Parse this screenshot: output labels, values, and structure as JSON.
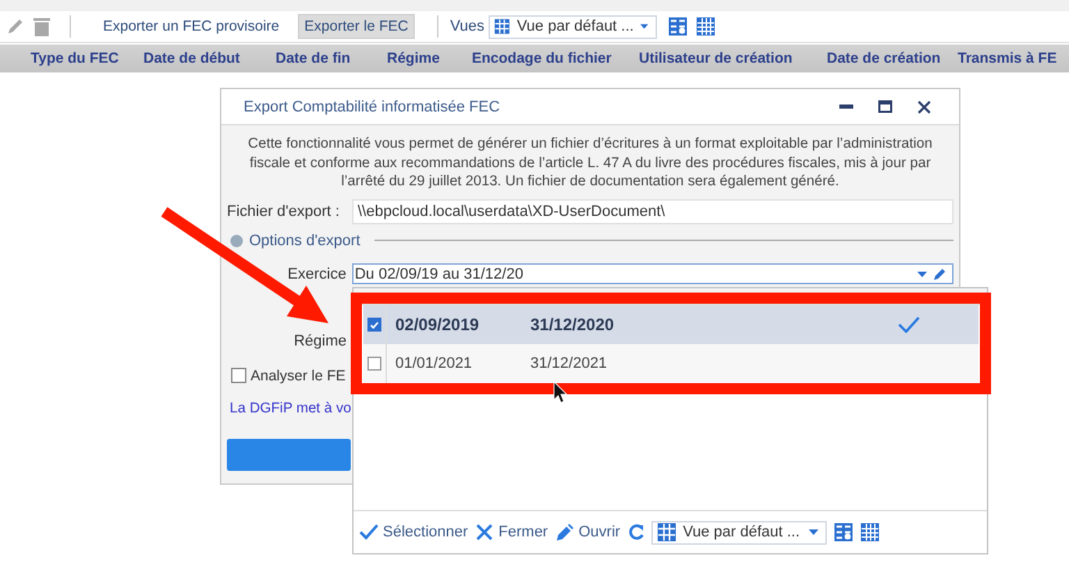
{
  "toolbar": {
    "actions": [
      {
        "label": "Exporter un FEC provisoire",
        "selected": false
      },
      {
        "label": "Exporter le FEC",
        "selected": true
      }
    ],
    "views_label": "Vues",
    "views_select": "Vue par défaut ..."
  },
  "table": {
    "columns": [
      "Type du FEC",
      "Date de début",
      "Date de fin",
      "Régime",
      "Encodage du fichier",
      "Utilisateur de création",
      "Date de création",
      "Transmis à FE"
    ]
  },
  "dialog": {
    "title": "Export Comptabilité informatisée FEC",
    "description": "Cette fonctionnalité vous permet de générer un fichier d’écritures à un format exploitable par l’administration fiscale et conforme aux recommandations de l’article L. 47 A du livre des procédures fiscales, mis à jour par l’arrêté du 29 juillet 2013. Un fichier de documentation sera également généré.",
    "file_label": "Fichier d'export :",
    "file_value": "\\\\ebpcloud.local\\userdata\\XD-UserDocument\\",
    "section": "Options d'export",
    "exercise_label": "Exercice",
    "exercise_value": "Du 02/09/19 au 31/12/20",
    "regime_label": "Régime",
    "analyse": {
      "label": "Analyser le FE",
      "checked": false
    },
    "link": "La DGFiP met à vo"
  },
  "popup": {
    "rows": [
      {
        "start": "02/09/2019",
        "end": "31/12/2020",
        "selected": true,
        "closed": true
      },
      {
        "start": "01/01/2021",
        "end": "31/12/2021",
        "selected": false,
        "closed": false
      }
    ],
    "footer": {
      "actions": [
        "Sélectionner",
        "Fermer",
        "Ouvrir"
      ],
      "view_select": "Vue par défaut ..."
    }
  }
}
